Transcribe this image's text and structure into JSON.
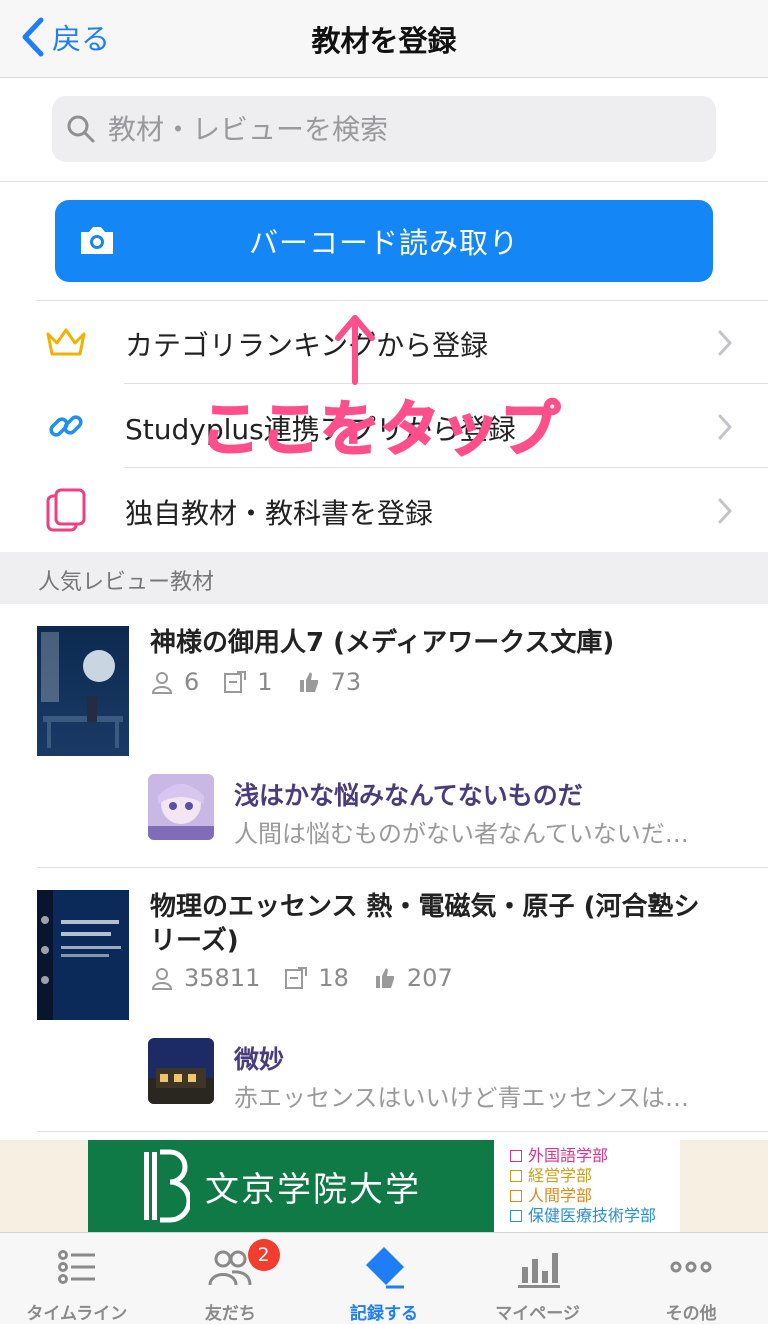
{
  "nav": {
    "back_label": "戻る",
    "title": "教材を登録"
  },
  "search": {
    "placeholder": "教材・レビューを検索"
  },
  "barcode": {
    "label": "バーコード読み取り"
  },
  "menu": {
    "items": [
      {
        "label": "カテゴリランキングから登録",
        "icon": "crown-icon"
      },
      {
        "label": "Studyplus連携アプリから登録",
        "icon": "link-icon"
      },
      {
        "label": "独自教材・教科書を登録",
        "icon": "notebook-icon"
      }
    ]
  },
  "annotation": {
    "text": "ここをタップ",
    "color": "#ff4f8b"
  },
  "section": {
    "title": "人気レビュー教材"
  },
  "books": [
    {
      "title": "神様の御用人7 (メディアワークス文庫)",
      "users": "6",
      "reviews": "1",
      "likes": "73",
      "review": {
        "title": "浅はかな悩みなんてないものだ",
        "text": "人間は悩むものがない者なんていないだ…"
      }
    },
    {
      "title": "物理のエッセンス 熱・電磁気・原子 (河合塾シリーズ)",
      "users": "35811",
      "reviews": "18",
      "likes": "207",
      "review": {
        "title": "微妙",
        "text": "赤エッセンスはいいけど青エッセンスは…"
      }
    }
  ],
  "ad": {
    "name": "文京学院大学",
    "faculties": [
      {
        "label": "外国語学部",
        "color": "#e0338a"
      },
      {
        "label": "経営学部",
        "color": "#c9a11a"
      },
      {
        "label": "人間学部",
        "color": "#e08a1e"
      },
      {
        "label": "保健医療技術学部",
        "color": "#2a8fd6"
      }
    ]
  },
  "tabs": [
    {
      "label": "タイムライン"
    },
    {
      "label": "友だち",
      "badge": "2"
    },
    {
      "label": "記録する"
    },
    {
      "label": "マイページ"
    },
    {
      "label": "その他"
    }
  ],
  "colors": {
    "accent": "#1f7ef5",
    "button": "#1586f5",
    "badge": "#f23c2e",
    "review_title": "#4a3c7a"
  }
}
